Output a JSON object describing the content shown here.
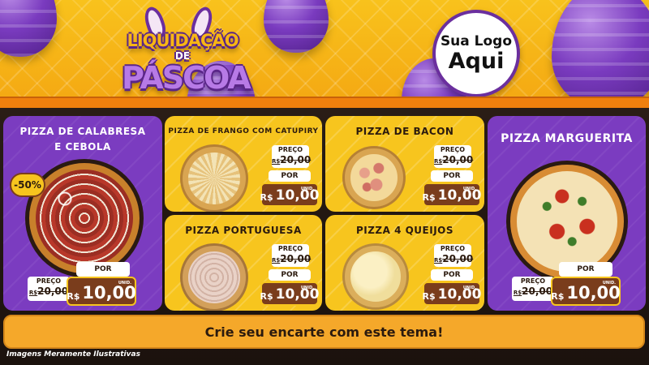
{
  "header": {
    "title_top": "LIQUIDAÇÃO",
    "title_mid": "DE",
    "title_bottom": "PÁSCOA",
    "logo_line1": "Sua Logo",
    "logo_line2": "Aqui"
  },
  "colors": {
    "purple": "#7b3cc0",
    "yellow": "#f7c51e",
    "orange": "#f0800d",
    "brown": "#7a3d1c"
  },
  "labels": {
    "preco": "PREÇO",
    "por": "POR",
    "rs": "R$",
    "unit": "UNID."
  },
  "products": [
    {
      "name": "PIZZA DE CALABRESA E CEBOLA",
      "old_price": "20,00",
      "price": "10,00",
      "discount": "-50%"
    },
    {
      "name": "PIZZA DE FRANGO COM CATUPIRY",
      "old_price": "20,00",
      "price": "10,00"
    },
    {
      "name": "PIZZA DE BACON",
      "old_price": "20,00",
      "price": "10,00"
    },
    {
      "name": "PIZZA MARGUERITA",
      "old_price": "20,00",
      "price": "10,00"
    },
    {
      "name": "PIZZA PORTUGUESA",
      "old_price": "20,00",
      "price": "10,00"
    },
    {
      "name": "PIZZA 4 QUEIJOS",
      "old_price": "20,00",
      "price": "10,00"
    }
  ],
  "cta_text": "Crie seu encarte com este tema!",
  "disclaimer": "Imagens Meramente Ilustrativas"
}
